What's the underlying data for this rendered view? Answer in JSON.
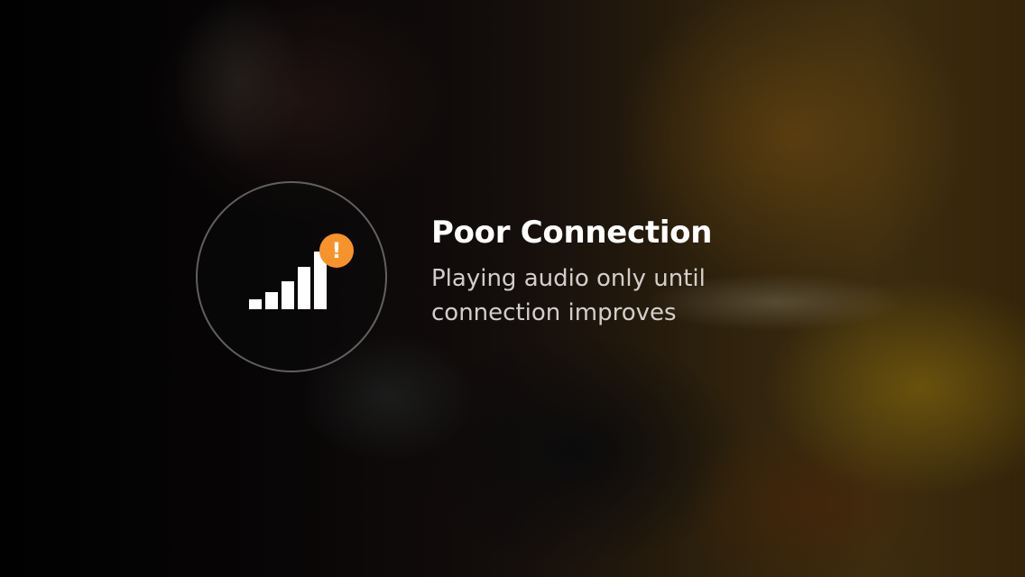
{
  "notice": {
    "icon": "signal-strength-icon",
    "badge_icon": "exclamation-icon",
    "badge_symbol": "!",
    "badge_color": "#f7932b",
    "title": "Poor Connection",
    "message_line1": "Playing audio only until",
    "message_line2": "connection improves"
  }
}
